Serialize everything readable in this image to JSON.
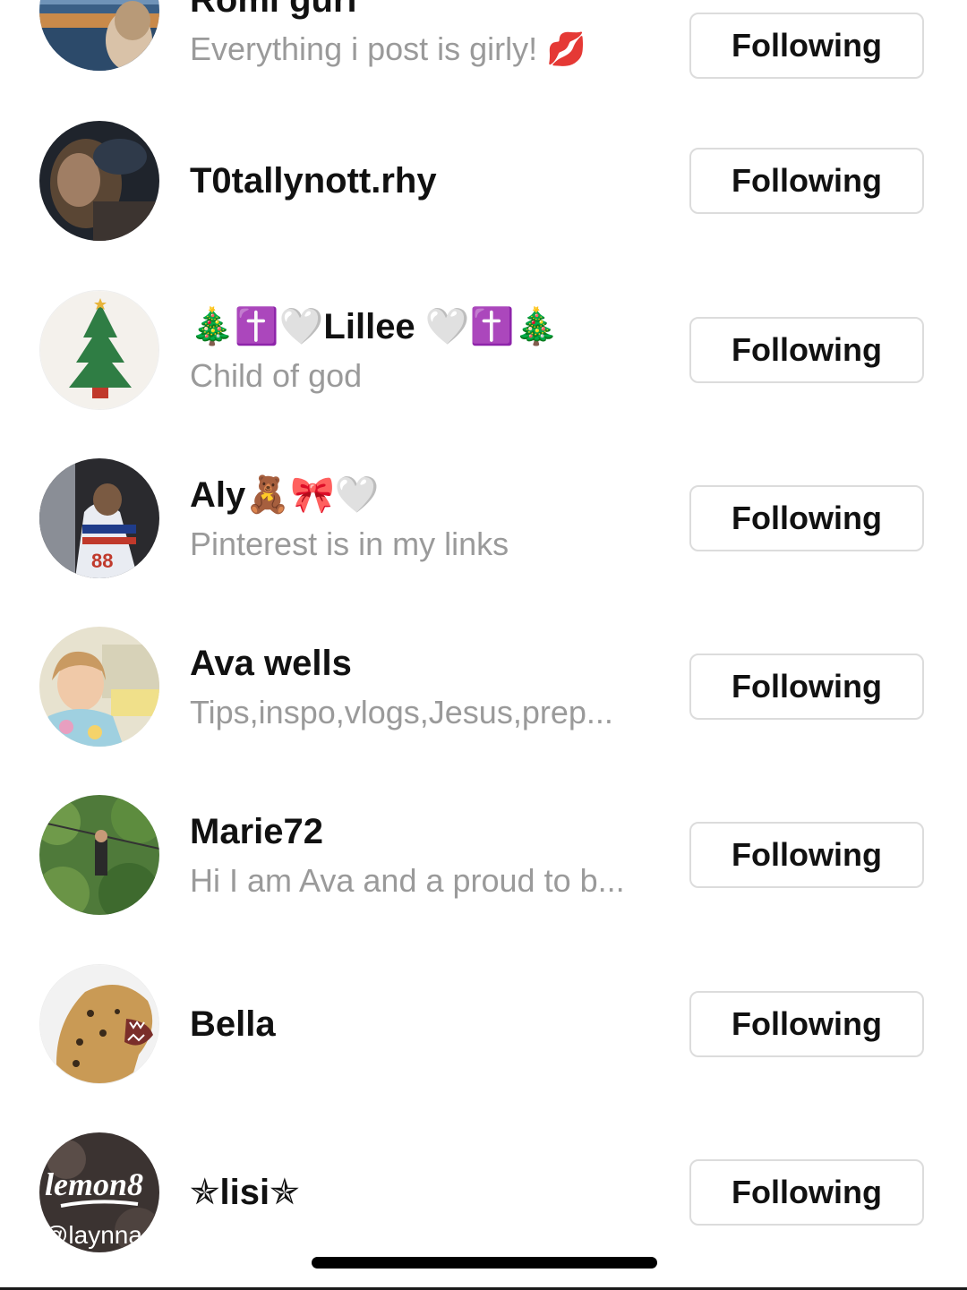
{
  "following_list": [
    {
      "name": "Romi gurl",
      "bio": "Everything i post is girly! 💋",
      "button": "Following",
      "avatar": "photo-ship-deck"
    },
    {
      "name": "T0tallynott.rhy",
      "bio": "",
      "button": "Following",
      "avatar": "photo-selfie-dark"
    },
    {
      "name": "🎄✝️🤍Lillee 🤍✝️🎄",
      "bio": "Child of god",
      "button": "Following",
      "avatar": "christmas-tree"
    },
    {
      "name": "Aly🧸🎀🤍",
      "bio": "Pinterest is in my links",
      "button": "Following",
      "avatar": "photo-hockey-jersey"
    },
    {
      "name": "Ava wells",
      "bio": "Tips,inspo,vlogs,Jesus,prep...",
      "button": "Following",
      "avatar": "photo-selfie-store"
    },
    {
      "name": "Marie72",
      "bio": "Hi I am Ava and a proud to b...",
      "button": "Following",
      "avatar": "photo-zipline-jungle"
    },
    {
      "name": "Bella",
      "bio": "",
      "button": "Following",
      "avatar": "leopard"
    },
    {
      "name": "✯lisi✯",
      "bio": "",
      "button": "Following",
      "avatar": "lemon8-logo",
      "avatar_text": {
        "logo": "lemon8",
        "handle": "@laynna"
      }
    }
  ]
}
